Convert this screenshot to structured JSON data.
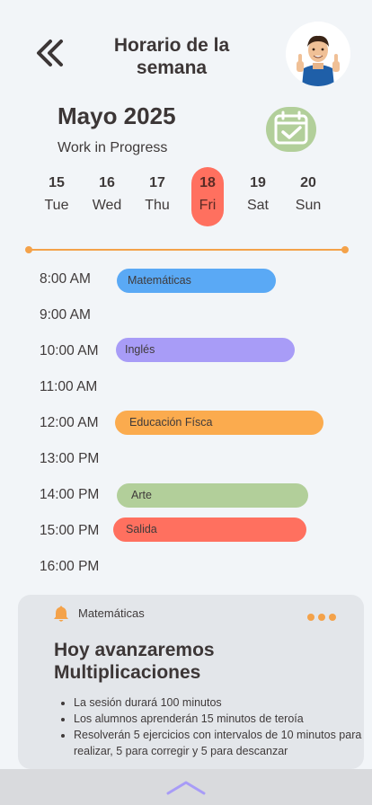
{
  "header": {
    "title": "Horario de la semana"
  },
  "calendar": {
    "month": "Mayo 2025",
    "status": "Work in Progress",
    "days": [
      {
        "num": "15",
        "wd": "Tue"
      },
      {
        "num": "16",
        "wd": "Wed"
      },
      {
        "num": "17",
        "wd": "Thu"
      },
      {
        "num": "18",
        "wd": "Fri"
      },
      {
        "num": "19",
        "wd": "Sat"
      },
      {
        "num": "20",
        "wd": "Sun"
      }
    ],
    "selected_day": "18"
  },
  "schedule": {
    "times": [
      "8:00 AM",
      "9:00 AM",
      "10:00 AM",
      "11:00 AM",
      "12:00 AM",
      "13:00 PM",
      "14:00 PM",
      "15:00 PM",
      "16:00 PM"
    ],
    "events": [
      {
        "label": "Matemáticas",
        "color": "#5aa9f5"
      },
      {
        "label": "Inglés",
        "color": "#a89cf7"
      },
      {
        "label": "Educación Físca",
        "color": "#fbab4e"
      },
      {
        "label": "Arte",
        "color": "#b2cf9a"
      },
      {
        "label": "Salida",
        "color": "#ff705f"
      }
    ]
  },
  "card": {
    "subject": "Matemáticas",
    "title": "Hoy avanzaremos Multiplicaciones",
    "items": [
      "La sesión durará 100 minutos",
      "Los alumnos aprenderán 15 minutos de teroía",
      "Resolverán 5 ejercicios con intervalos de 10 minutos para realizar, 5 para corregir y 5 para descanzar"
    ]
  },
  "colors": {
    "accent_orange": "#f4a24a",
    "selected_day": "#ff705f",
    "calendar_badge": "#b2cf9a"
  }
}
